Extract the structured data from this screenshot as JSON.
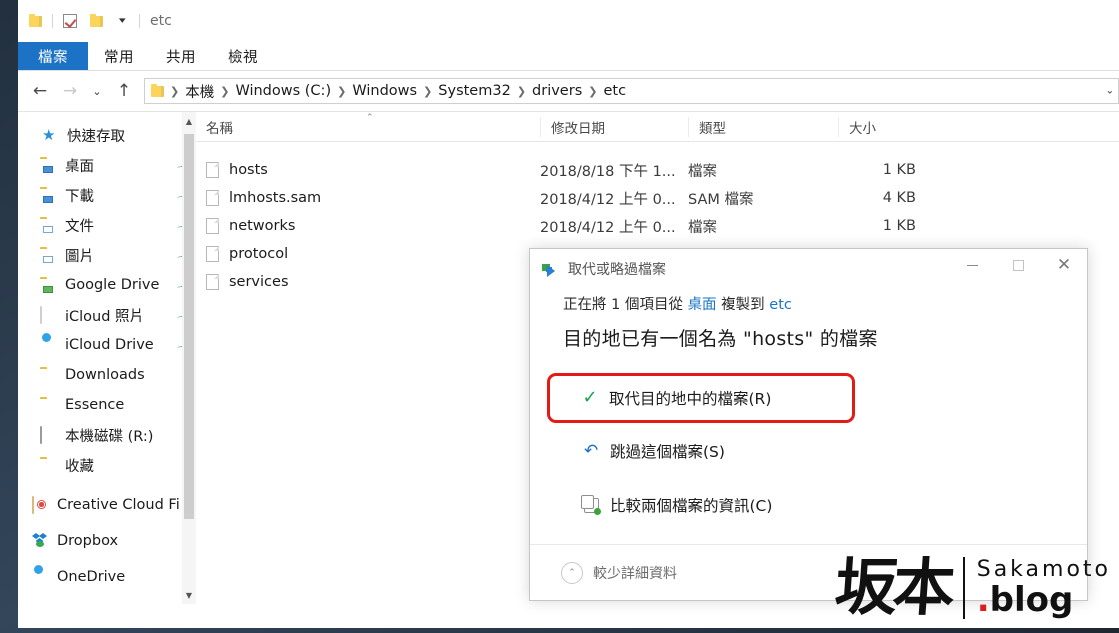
{
  "window": {
    "title": "etc",
    "quick_access": [
      "folder-icon",
      "checkbox-icon",
      "folder-icon",
      "dropdown-caret-icon"
    ]
  },
  "ribbon": {
    "tabs": [
      {
        "label": "檔案",
        "active": true
      },
      {
        "label": "常用",
        "active": false
      },
      {
        "label": "共用",
        "active": false
      },
      {
        "label": "檢視",
        "active": false
      }
    ],
    "accent_color": "#1c72c4"
  },
  "address_bar": {
    "back_icon": "arrow-left-icon",
    "forward_icon": "arrow-right-icon",
    "recent_icon": "chevron-down-icon",
    "up_icon": "arrow-up-icon",
    "breadcrumbs": [
      "本機",
      "Windows (C:)",
      "Windows",
      "System32",
      "drivers",
      "etc"
    ],
    "separator": "›"
  },
  "nav_pane": {
    "root_label": "快速存取",
    "items": [
      {
        "label": "桌面",
        "icon": "folder-desktop-icon",
        "pinned": true
      },
      {
        "label": "下載",
        "icon": "folder-download-icon",
        "pinned": true
      },
      {
        "label": "文件",
        "icon": "folder-documents-icon",
        "pinned": true
      },
      {
        "label": "圖片",
        "icon": "folder-pictures-icon",
        "pinned": true
      },
      {
        "label": "Google Drive",
        "icon": "folder-gdrive-icon",
        "pinned": true
      },
      {
        "label": "iCloud 照片",
        "icon": "icloud-photos-icon",
        "pinned": true
      },
      {
        "label": "iCloud Drive",
        "icon": "icloud-drive-icon",
        "pinned": true
      },
      {
        "label": "Downloads",
        "icon": "folder-icon",
        "pinned": false
      },
      {
        "label": "Essence",
        "icon": "folder-icon",
        "pinned": false
      },
      {
        "label": "本機磁碟 (R:)",
        "icon": "disk-drive-icon",
        "pinned": false
      },
      {
        "label": "收藏",
        "icon": "folder-icon",
        "pinned": false
      }
    ],
    "services": [
      {
        "label": "Creative Cloud Fi",
        "icon": "creative-cloud-icon"
      },
      {
        "label": "Dropbox",
        "icon": "dropbox-icon"
      },
      {
        "label": "OneDrive",
        "icon": "onedrive-icon"
      }
    ]
  },
  "file_list": {
    "columns": [
      "名稱",
      "修改日期",
      "類型",
      "大小"
    ],
    "sort_column": "名稱",
    "sort_direction": "asc",
    "rows": [
      {
        "name": "hosts",
        "date": "2018/8/18 下午 1...",
        "type": "檔案",
        "size": "1 KB"
      },
      {
        "name": "lmhosts.sam",
        "date": "2018/4/12 上午 0...",
        "type": "SAM 檔案",
        "size": "4 KB"
      },
      {
        "name": "networks",
        "date": "2018/4/12 上午 0...",
        "type": "檔案",
        "size": "1 KB"
      },
      {
        "name": "protocol",
        "date": "",
        "type": "",
        "size": ""
      },
      {
        "name": "services",
        "date": "",
        "type": "",
        "size": ""
      }
    ]
  },
  "dialog": {
    "title": "取代或略過檔案",
    "title_icon": "copy-file-icon",
    "minimize_icon": "minimize-icon",
    "maximize_icon": "maximize-icon",
    "close_icon": "close-icon",
    "subtitle_prefix": "正在將 1 個項目從 ",
    "subtitle_source": "桌面",
    "subtitle_middle": " 複製到 ",
    "subtitle_target": "etc",
    "heading": "目的地已有一個名為 \"hosts\" 的檔案",
    "options": [
      {
        "label": "取代目的地中的檔案(R)",
        "icon": "green-check-icon",
        "highlighted": true
      },
      {
        "label": "跳過這個檔案(S)",
        "icon": "skip-arrow-icon",
        "highlighted": false
      },
      {
        "label": "比較兩個檔案的資訊(C)",
        "icon": "compare-files-icon",
        "highlighted": false
      }
    ],
    "footer_label": "較少詳細資料",
    "footer_icon": "chevron-up-circle-icon",
    "highlight_color": "#e31b16"
  },
  "watermark": {
    "cjk": "坂本",
    "name": "Sakamoto",
    "domain": "blog",
    "dot": ".",
    "dot_color": "#d81e1e"
  }
}
